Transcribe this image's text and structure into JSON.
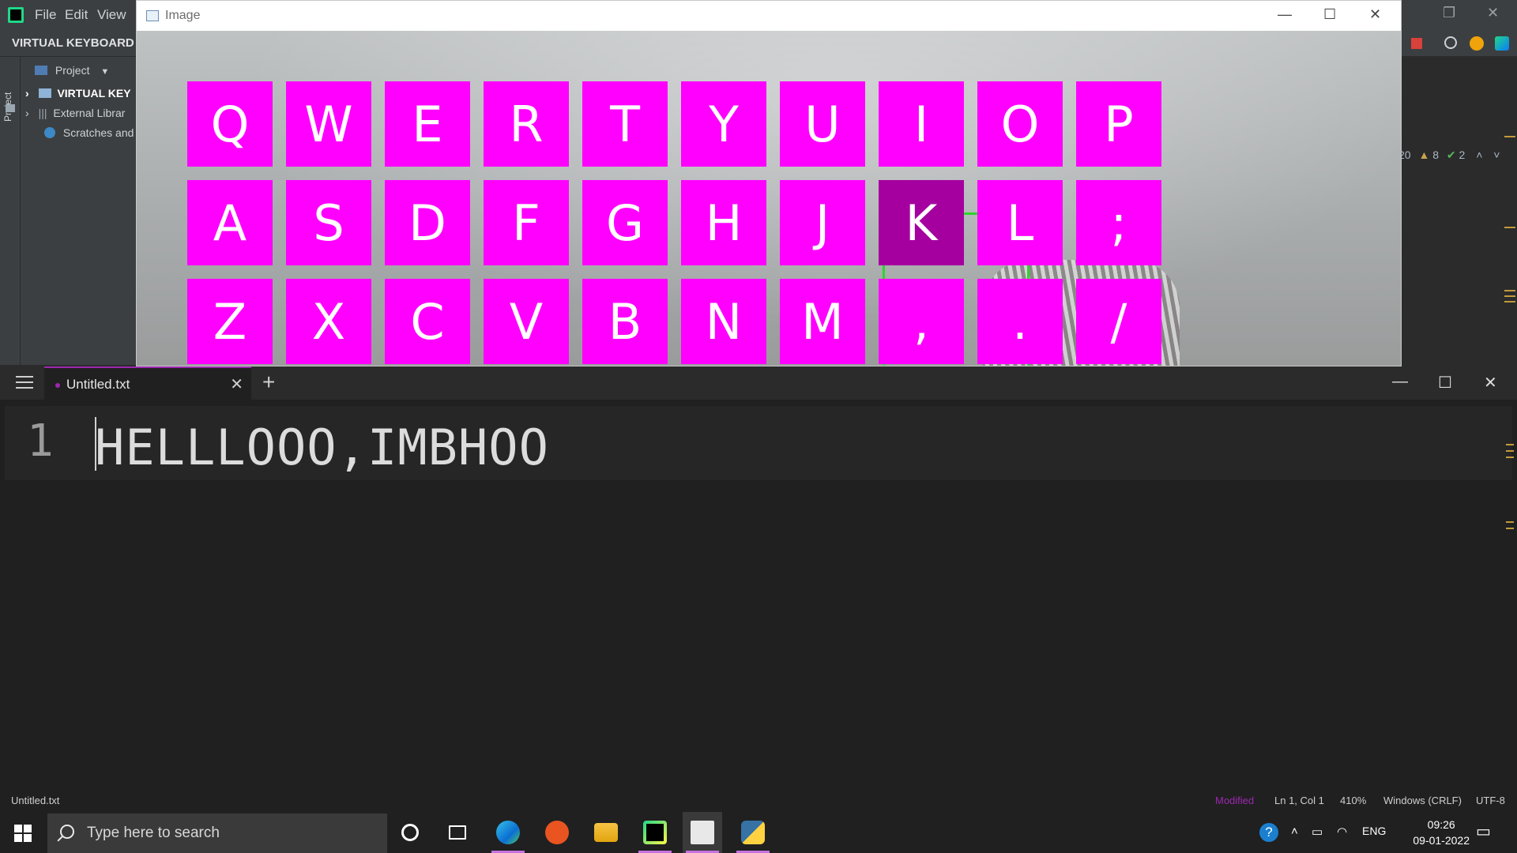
{
  "pycharm": {
    "menu": [
      "File",
      "Edit",
      "View"
    ],
    "project_title": "VIRTUAL KEYBOARD",
    "side_strip_label": "Project",
    "panel_header": "Project",
    "tree": [
      "VIRTUAL KEY",
      "External Librar",
      "Scratches and"
    ],
    "inspections": {
      "weak_warnings": "20",
      "warnings": "8",
      "typos": "2"
    }
  },
  "image_window": {
    "title": "Image",
    "keys": [
      [
        "Q",
        "W",
        "E",
        "R",
        "T",
        "Y",
        "U",
        "I",
        "O",
        "P"
      ],
      [
        "A",
        "S",
        "D",
        "F",
        "G",
        "H",
        "J",
        "K",
        "L",
        ";"
      ],
      [
        "Z",
        "X",
        "C",
        "V",
        "B",
        "N",
        "M",
        ",",
        ".",
        "/"
      ]
    ],
    "active_key": "K",
    "colors": {
      "key": "#ff00ff",
      "key_active": "#a5009f",
      "detection_box": "#2fd42f"
    }
  },
  "editor": {
    "tab_name": "Untitled.txt",
    "line_number": "1",
    "text": "HELLLOOO,IMBHOO",
    "status": {
      "file": "Untitled.txt",
      "modified": "Modified",
      "position": "Ln 1, Col 1",
      "zoom": "410%",
      "line_endings": "Windows (CRLF)",
      "encoding": "UTF-8"
    },
    "accent": "#9c27b0"
  },
  "taskbar": {
    "search_placeholder": "Type here to search",
    "apps": [
      "cortana-icon",
      "task-view-icon",
      "edge-icon",
      "ubuntu-icon",
      "file-explorer-icon",
      "pycharm-icon",
      "notepad-icon",
      "python-icon"
    ],
    "language": "ENG",
    "time": "09:26",
    "date": "09-01-2022"
  }
}
